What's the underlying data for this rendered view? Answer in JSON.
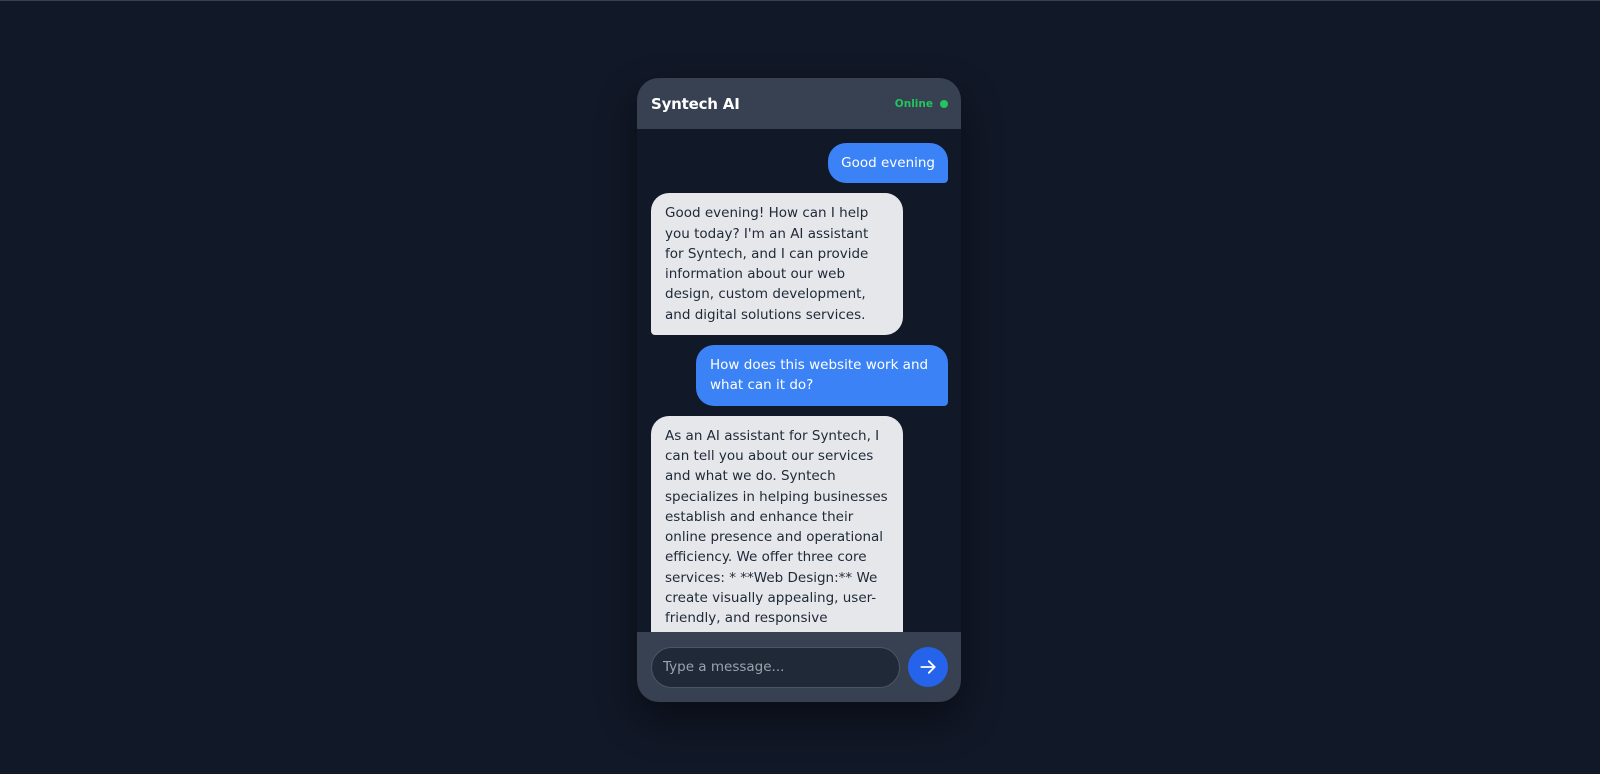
{
  "header": {
    "title": "Syntech AI",
    "status": "Online"
  },
  "messages": [
    {
      "role": "user",
      "text": "Good evening"
    },
    {
      "role": "assistant",
      "text": "Good evening! How can I help you today? I'm an AI assistant for Syntech, and I can provide information about our web design, custom development, and digital solutions services."
    },
    {
      "role": "user",
      "text": "How does this website work and what can it do?"
    },
    {
      "role": "assistant",
      "text": "As an AI assistant for Syntech, I can tell you about our services and what we do. Syntech specializes in helping businesses establish and enhance their online presence and operational efficiency. We offer three core services: * **Web Design:** We create visually appealing, user-friendly, and responsive websites tailored to"
    }
  ],
  "composer": {
    "placeholder": "Type a message...",
    "value": ""
  },
  "icons": {
    "status": "status-dot-icon",
    "send": "arrow-right-icon"
  },
  "colors": {
    "background": "#111827",
    "panel": "#374151",
    "user_bubble": "#3b82f6",
    "assistant_bubble": "#e5e7eb",
    "online": "#22c55e",
    "send_button": "#2563eb"
  }
}
